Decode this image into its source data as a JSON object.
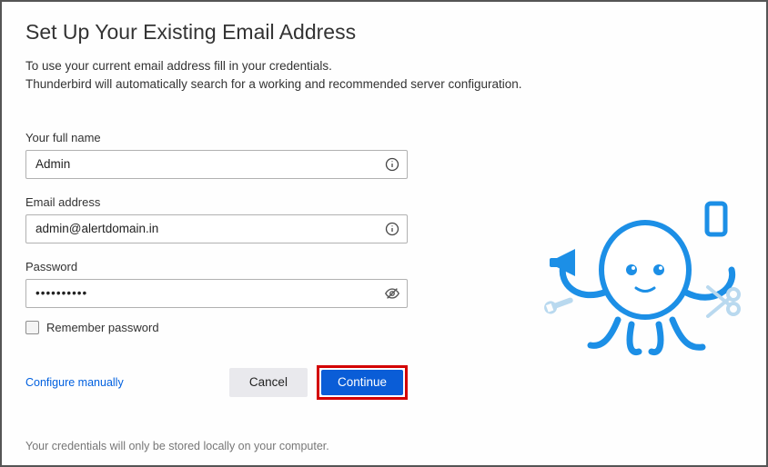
{
  "heading": "Set Up Your Existing Email Address",
  "subtext_line1": "To use your current email address fill in your credentials.",
  "subtext_line2": "Thunderbird will automatically search for a working and recommended server configuration.",
  "fields": {
    "name": {
      "label": "Your full name",
      "value": "Admin"
    },
    "email": {
      "label": "Email address",
      "value": "admin@alertdomain.in"
    },
    "password": {
      "label": "Password",
      "value": "••••••••••"
    }
  },
  "remember": {
    "label": "Remember password",
    "checked": false
  },
  "actions": {
    "configure_manually": "Configure manually",
    "cancel": "Cancel",
    "continue": "Continue"
  },
  "footer": "Your credentials will only be stored locally on your computer."
}
